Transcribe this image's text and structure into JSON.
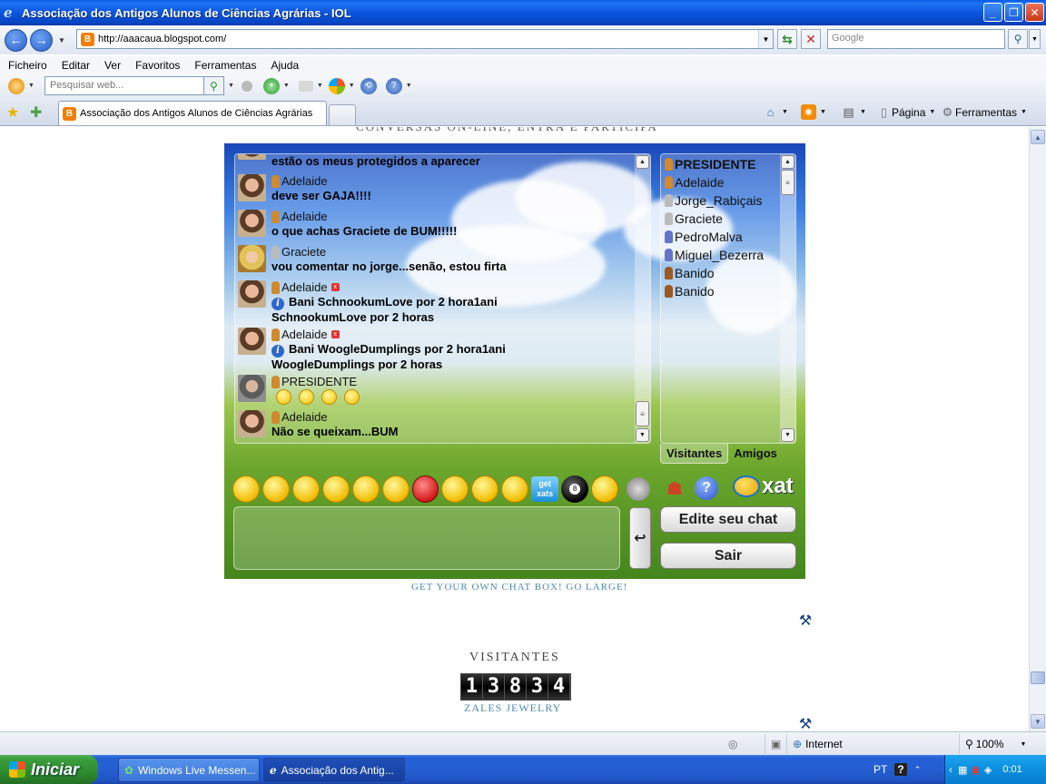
{
  "window": {
    "title": "Associação dos Antigos Alunos de Ciências Agrárias - IOL",
    "min_label": "_",
    "max_label": "❐",
    "close_label": "✕"
  },
  "address": {
    "url": "http://aaacaua.blogspot.com/",
    "search_placeholder": "Google"
  },
  "menu": [
    "Ficheiro",
    "Editar",
    "Ver",
    "Favoritos",
    "Ferramentas",
    "Ajuda"
  ],
  "toolbar": {
    "search_placeholder": "Pesquisar web..."
  },
  "tabs": {
    "active_label": "Associação dos Antigos Alunos de Ciências Agrárias",
    "page_label": "Página",
    "tools_label": "Ferramentas"
  },
  "page": {
    "heading_cut": "CONVERSAS ON-LINE, ENTRA E PARTICIPA",
    "chat": {
      "messages": [
        {
          "user": "",
          "text": "estão os meus protegidos a aparecer"
        },
        {
          "user": "Adelaide",
          "text": "deve ser GAJA!!!!"
        },
        {
          "user": "Adelaide",
          "text": "o que achas Graciete de BUM!!!!!"
        },
        {
          "user": "Graciete",
          "text": "vou comentar no jorge...senão, estou firta"
        },
        {
          "user": "Adelaide",
          "line1": "Bani SchnookumLove por 2 hora1ani",
          "line2": "SchnookumLove por 2 horas"
        },
        {
          "user": "Adelaide",
          "line1": "Bani WoogleDumplings por 2 hora1ani",
          "line2": "WoogleDumplings por 2 horas"
        },
        {
          "user": "PRESIDENTE",
          "text": ""
        },
        {
          "user": "Adelaide",
          "text": "Não se queixam...BUM"
        }
      ],
      "users": [
        "PRESIDENTE",
        "Adelaide",
        "Jorge_Rabiçais",
        "Graciete",
        "PedroMalva",
        "Miguel_Bezerra",
        "Banido",
        "Banido"
      ],
      "tab_visitors": "Visitantes",
      "tab_friends": "Amigos",
      "get_xats": "get xats",
      "ball_label": "8",
      "help_label": "?",
      "xat_logo": "xat",
      "send_label": "↩",
      "edit_button": "Edite seu chat",
      "exit_button": "Sair"
    },
    "get_chat_link": "GET YOUR OWN CHAT BOX! GO LARGE!",
    "visitors_title": "VISITANTES",
    "counter_digits": [
      "1",
      "3",
      "8",
      "3",
      "4"
    ],
    "zales_link": "ZALES JEWELRY"
  },
  "statusbar": {
    "zone": "Internet",
    "zoom": "100%"
  },
  "taskbar": {
    "start_label": "Iniciar",
    "task1": "Windows Live Messen...",
    "task2": "Associação dos Antig...",
    "lang": "PT",
    "help_label": "?",
    "clock": "0:01"
  }
}
